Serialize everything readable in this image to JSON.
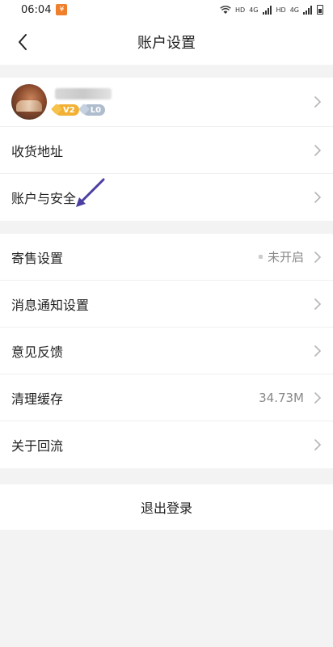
{
  "status_bar": {
    "time": "06:04",
    "app_badge": "¥",
    "net1": "HD",
    "net2": "4G",
    "net3": "HD",
    "net4": "4G"
  },
  "nav": {
    "title": "账户设置",
    "back_icon": "chevron-left-icon"
  },
  "profile": {
    "level_vip": "V2",
    "level_user": "L0"
  },
  "group1": {
    "address": {
      "label": "收货地址"
    },
    "security": {
      "label": "账户与安全"
    }
  },
  "group2": {
    "consign": {
      "label": "寄售设置",
      "value": "未开启"
    },
    "notify": {
      "label": "消息通知设置"
    },
    "feedback": {
      "label": "意见反馈"
    },
    "cache": {
      "label": "清理缓存",
      "value": "34.73M"
    },
    "about": {
      "label": "关于回流"
    }
  },
  "logout": {
    "label": "退出登录"
  },
  "colors": {
    "accent_arrow": "#4b3fa0",
    "vip_badge": "#f2b134",
    "level_badge": "#aebccd"
  }
}
